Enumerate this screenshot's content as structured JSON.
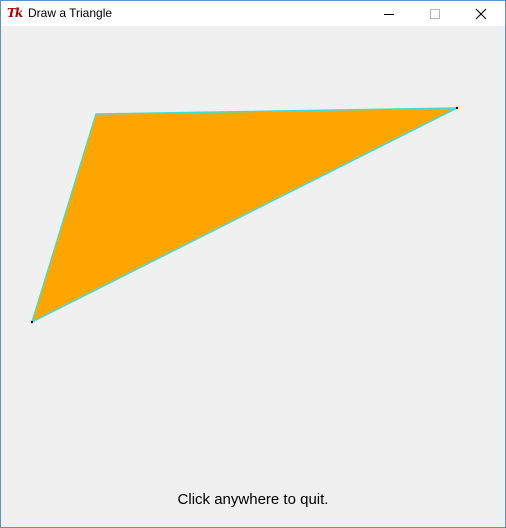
{
  "window": {
    "title": "Draw a Triangle",
    "app_icon": "tk-feather-icon",
    "app_icon_text": "Tk",
    "controls": {
      "minimize": "minimize-icon",
      "maximize": "maximize-icon",
      "close": "close-icon"
    }
  },
  "canvas": {
    "triangle": {
      "fill": "#ffa500",
      "outline": "#40e0d0"
    },
    "message": "Click anywhere to quit."
  }
}
